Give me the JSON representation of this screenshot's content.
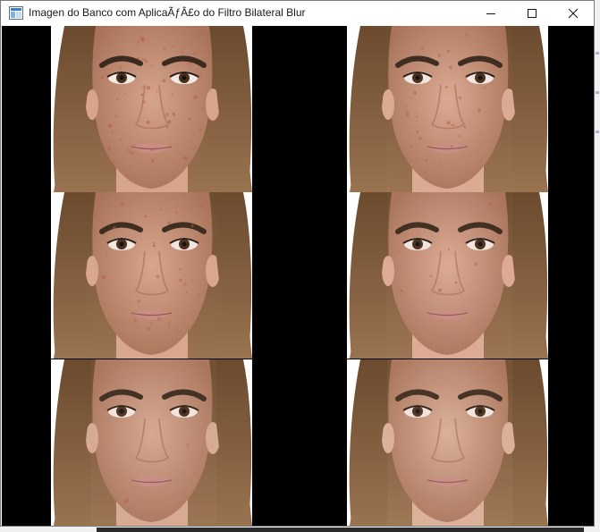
{
  "window": {
    "title": "Imagen do Banco com AplicaÃƒÂ£o do Filtro Bilateral Blur",
    "icon": "opencv-window-icon",
    "buttons": {
      "minimize": "minimize-icon",
      "maximize": "maximize-icon",
      "close": "close-icon"
    }
  },
  "grid": {
    "rows": 3,
    "cols": 2,
    "background": "#000000",
    "cells": [
      {
        "id": "r1c1",
        "blemish_level": 1.0,
        "smoothing": 0.0,
        "tone": "#d6a58c"
      },
      {
        "id": "r1c2",
        "blemish_level": 0.55,
        "smoothing": 0.35,
        "tone": "#dcaa94"
      },
      {
        "id": "r2c1",
        "blemish_level": 0.5,
        "smoothing": 0.3,
        "tone": "#d9a78e"
      },
      {
        "id": "r2c2",
        "blemish_level": 0.2,
        "smoothing": 0.6,
        "tone": "#ddab96"
      },
      {
        "id": "r3c1",
        "blemish_level": 0.05,
        "smoothing": 0.85,
        "tone": "#d8ab93"
      },
      {
        "id": "r3c2",
        "blemish_level": 0.0,
        "smoothing": 1.0,
        "tone": "#dcb19b"
      }
    ]
  },
  "colors": {
    "hair": "#6b4a2e",
    "hair_light": "#9a7350",
    "brow": "#3b2a1e",
    "iris": "#4a2f1c",
    "lips": "#c98d86",
    "blemish": "#b8614e"
  }
}
